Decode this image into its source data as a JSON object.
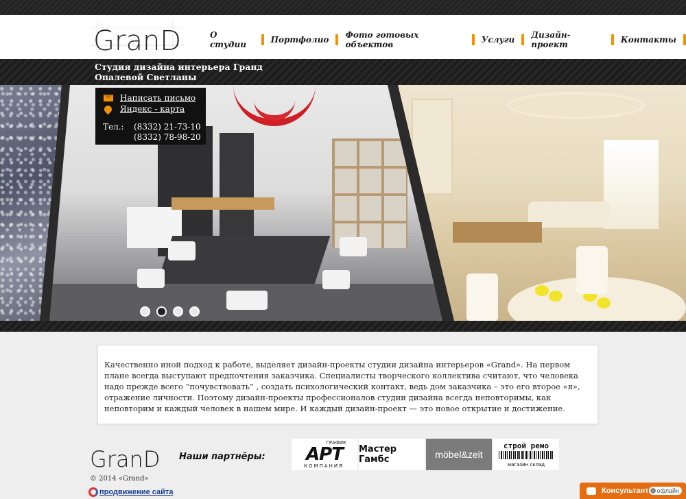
{
  "header": {
    "logo_text": "GranD",
    "nav": [
      {
        "label": "О студии"
      },
      {
        "label": "Портфолио"
      },
      {
        "label": "Фото готовых объектов"
      },
      {
        "label": "Услуги"
      },
      {
        "label": "Дизайн-проект"
      },
      {
        "label": "Контакты"
      }
    ]
  },
  "tagline": {
    "line1": "Студия дизайна интерьера Гранд",
    "line2": "Опалевой Светланы"
  },
  "contact": {
    "mail_link": "Написать письмо",
    "map_link": "Яндекс - карта",
    "phone_label": "Тел.:",
    "phone1": "(8332) 21-73-10",
    "phone2": "(8332) 78-98-20",
    "icons": [
      "envelope-icon",
      "map-pin-icon"
    ]
  },
  "slider": {
    "dots": 4,
    "active_index": 1
  },
  "about": {
    "text": "Качественно иной подход к работе, выделяет дизайн-проекты студии дизайна интерьеров «Grand». На первом плане всегда выступают предпочтения заказчика. Специалисты творческого коллектива считают, что человека надо прежде всего “почувствовать” , создать психологический контакт, ведь дом заказчика – это его второе «я», отражение личности. Поэтому дизайн-проекты профессионалов студии дизайна всегда неповторимы, как неповторим и каждый человек в нашем мире. И каждый дизайн-проект — это новое открытие и достижение."
  },
  "footer": {
    "logo_text": "GranD",
    "copyright": "© 2014 «Grand»",
    "promo_link": "продвижение сайта",
    "partners_label": "Наши партнёры:",
    "partners": [
      {
        "name": "АРТ",
        "top": "ГРАФИК",
        "bottom": "КОМПАНИЯ"
      },
      {
        "name": "Мастер Гамбс"
      },
      {
        "name": "möbel&zeit"
      },
      {
        "name": "строй ремо",
        "sub": "магазин склад"
      }
    ]
  },
  "consultant": {
    "label": "Консультант",
    "status": "офлайн"
  },
  "colors": {
    "accent": "#f39200",
    "dark": "#1f1f1f",
    "consult": "#e46d12"
  }
}
